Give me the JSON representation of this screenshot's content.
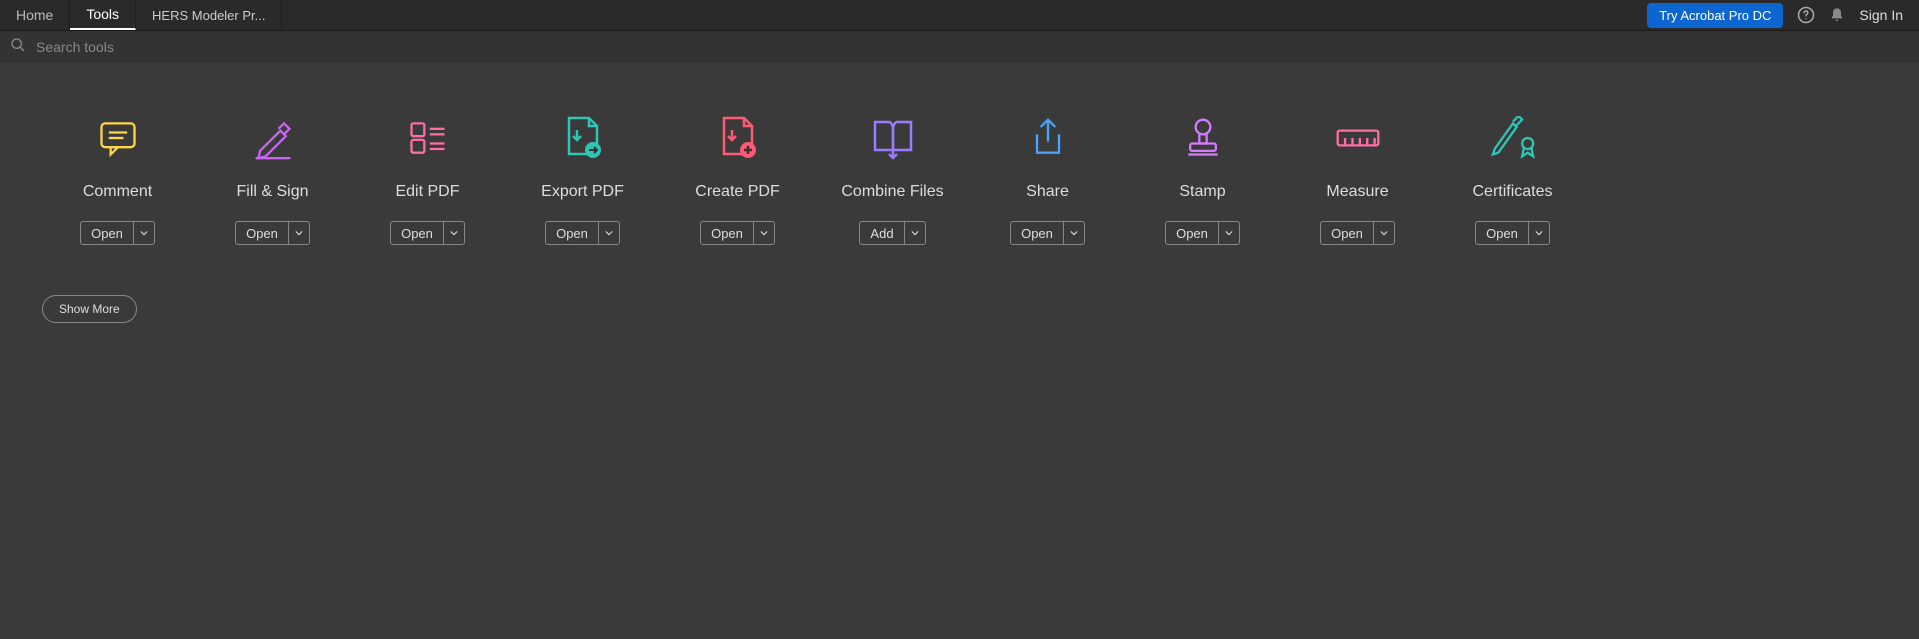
{
  "header": {
    "tabs": {
      "home": "Home",
      "tools": "Tools"
    },
    "doc_tab": "HERS Modeler Pr...",
    "try_button": "Try Acrobat Pro DC",
    "signin": "Sign In"
  },
  "search": {
    "placeholder": "Search tools"
  },
  "tools": [
    {
      "name": "comment",
      "label": "Comment",
      "button": "Open",
      "color": "#ffd54a"
    },
    {
      "name": "fill-sign",
      "label": "Fill & Sign",
      "button": "Open",
      "color": "#c766ef"
    },
    {
      "name": "edit-pdf",
      "label": "Edit PDF",
      "button": "Open",
      "color": "#ff6da6"
    },
    {
      "name": "export-pdf",
      "label": "Export PDF",
      "button": "Open",
      "color": "#2fc6b6"
    },
    {
      "name": "create-pdf",
      "label": "Create PDF",
      "button": "Open",
      "color": "#ff5a75"
    },
    {
      "name": "combine-files",
      "label": "Combine Files",
      "button": "Add",
      "color": "#9b7bff"
    },
    {
      "name": "share",
      "label": "Share",
      "button": "Open",
      "color": "#4aa3ff"
    },
    {
      "name": "stamp",
      "label": "Stamp",
      "button": "Open",
      "color": "#d67bff"
    },
    {
      "name": "measure",
      "label": "Measure",
      "button": "Open",
      "color": "#ff6da6"
    },
    {
      "name": "certificates",
      "label": "Certificates",
      "button": "Open",
      "color": "#2fc6b6"
    }
  ],
  "show_more": "Show More"
}
